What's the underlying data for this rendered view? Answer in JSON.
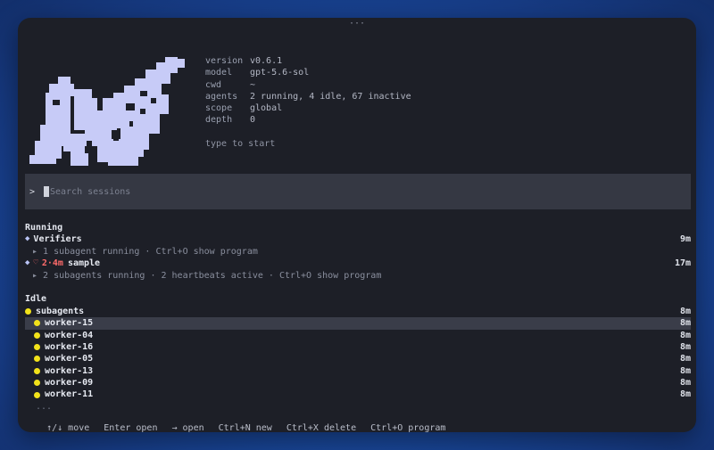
{
  "window": {
    "top_dots": "···"
  },
  "logo": {
    "name": "pixel-logo",
    "color": "#c7cbf7"
  },
  "info": {
    "rows": [
      {
        "key": "version",
        "value": "v0.6.1"
      },
      {
        "key": "model",
        "value": "gpt-5.6-sol"
      },
      {
        "key": "cwd",
        "value": "~"
      },
      {
        "key": "agents",
        "value": "2 running, 4 idle, 67 inactive"
      },
      {
        "key": "scope",
        "value": "global"
      },
      {
        "key": "depth",
        "value": "0"
      }
    ],
    "hint": "type to start"
  },
  "search": {
    "prompt": ">",
    "placeholder": "Search sessions",
    "value": ""
  },
  "running": {
    "title": "Running",
    "items": [
      {
        "icon": "diamond-icon",
        "name": "Verifiers",
        "time": "9m",
        "detail": "▸ 1 subagent running · Ctrl+O show program"
      },
      {
        "icon": "diamond-icon",
        "heart": "♡",
        "badge": "2·4m",
        "name": "sample",
        "time": "17m",
        "detail": "▸ 2 subagents running · 2 heartbeats active · Ctrl+O show program"
      }
    ]
  },
  "idle": {
    "title": "Idle",
    "group": {
      "name": "subagents",
      "time": "8m"
    },
    "workers": [
      {
        "name": "worker-15",
        "time": "8m",
        "selected": true
      },
      {
        "name": "worker-04",
        "time": "8m"
      },
      {
        "name": "worker-16",
        "time": "8m"
      },
      {
        "name": "worker-05",
        "time": "8m"
      },
      {
        "name": "worker-13",
        "time": "8m"
      },
      {
        "name": "worker-09",
        "time": "8m"
      },
      {
        "name": "worker-11",
        "time": "8m"
      }
    ],
    "more": "..."
  },
  "footer": {
    "move": "↑/↓ move",
    "enter": "Enter open",
    "arrow": "→ open",
    "new": "Ctrl+N new",
    "delete": "Ctrl+X delete",
    "program": "Ctrl+O program"
  }
}
